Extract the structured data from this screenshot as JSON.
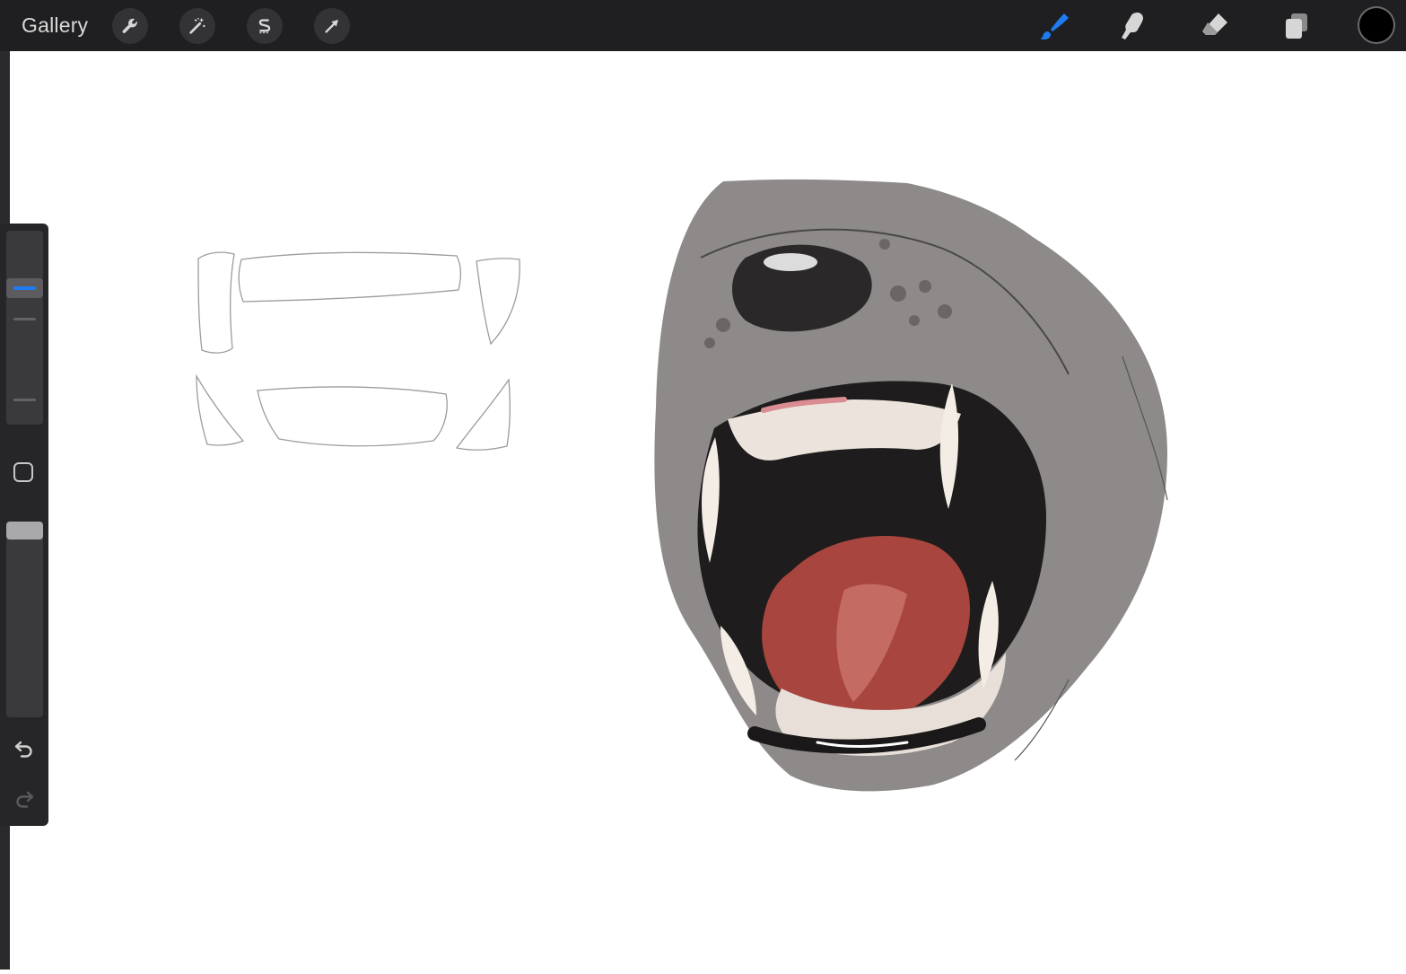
{
  "topbar": {
    "gallery_label": "Gallery",
    "left_tools": [
      {
        "name": "actions",
        "icon": "wrench-icon"
      },
      {
        "name": "adjustments",
        "icon": "magic-wand-icon"
      },
      {
        "name": "selection",
        "icon": "selection-s-icon"
      },
      {
        "name": "transform",
        "icon": "arrow-cursor-icon"
      }
    ],
    "right_tools": [
      {
        "name": "brush",
        "icon": "brush-icon",
        "active": true
      },
      {
        "name": "smudge",
        "icon": "smudge-finger-icon",
        "active": false
      },
      {
        "name": "eraser",
        "icon": "eraser-icon",
        "active": false
      },
      {
        "name": "layers",
        "icon": "layers-icon",
        "active": false
      }
    ],
    "current_color": "#000000"
  },
  "sidebar": {
    "brush_size_level": 0.78,
    "opacity_level": 1.0,
    "modify_icon": "square-icon",
    "undo_icon": "undo-icon",
    "redo_icon": "redo-icon",
    "redo_enabled": false
  },
  "colors": {
    "accent": "#1e7cf2",
    "topbar": "#1f1f21",
    "sidebar": "#262628",
    "canvas": "#ffffff"
  },
  "canvas": {
    "artwork": "sketch-and-painted-animal-mouth"
  }
}
